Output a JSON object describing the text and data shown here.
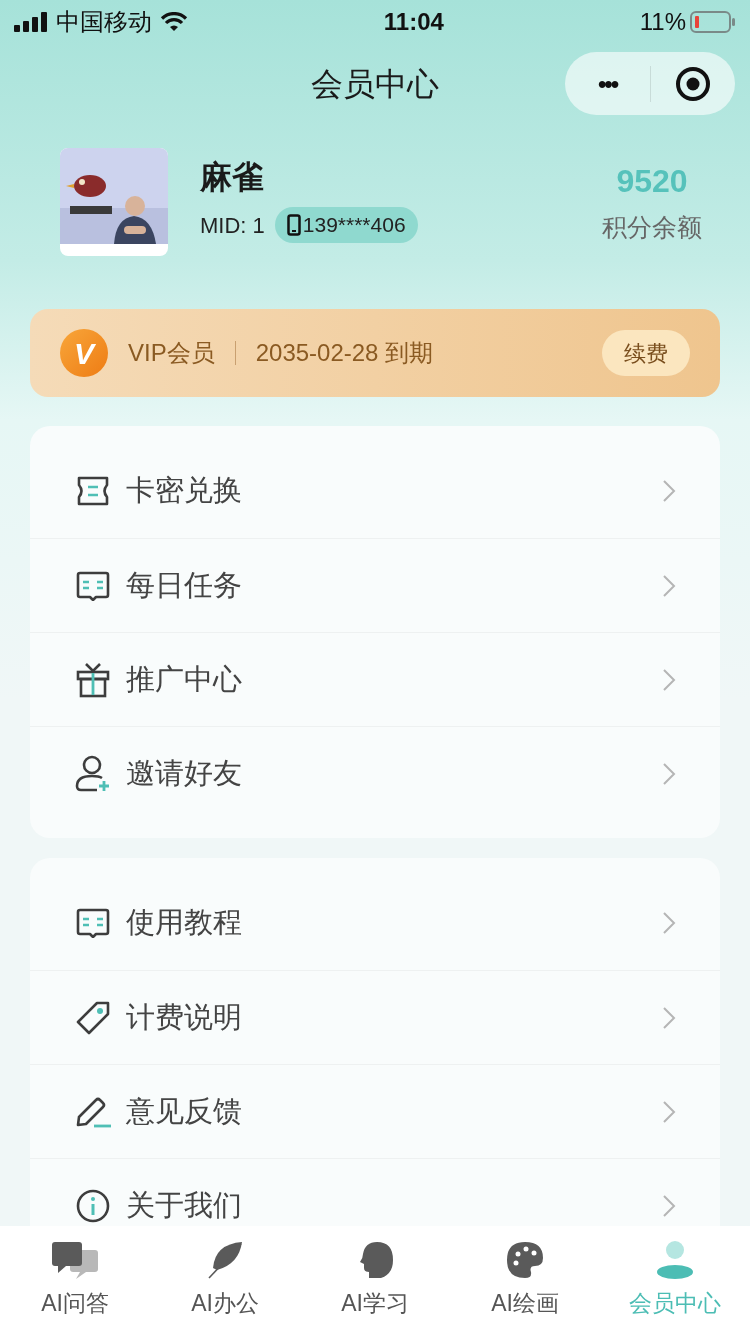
{
  "status_bar": {
    "carrier": "中国移动",
    "time": "11:04",
    "battery": "11%"
  },
  "nav": {
    "title": "会员中心",
    "more_icon": "•••"
  },
  "profile": {
    "name": "麻雀",
    "mid": "MID: 1",
    "phone": "139****406",
    "points": "9520",
    "points_label": "积分余额"
  },
  "vip": {
    "badge": "V",
    "label": "VIP会员",
    "expiry": "2035-02-28 到期",
    "button": "续费"
  },
  "menu_groups": [
    {
      "items": [
        {
          "label": "卡密兑换",
          "kind": "ticket"
        },
        {
          "label": "每日任务",
          "kind": "book"
        },
        {
          "label": "推广中心",
          "kind": "gift"
        },
        {
          "label": "邀请好友",
          "kind": "invite"
        }
      ]
    },
    {
      "items": [
        {
          "label": "使用教程",
          "kind": "book"
        },
        {
          "label": "计费说明",
          "kind": "tag"
        },
        {
          "label": "意见反馈",
          "kind": "pen"
        },
        {
          "label": "关于我们",
          "kind": "info"
        }
      ]
    }
  ],
  "tab_bar": [
    {
      "label": "AI问答",
      "kind": "chat",
      "selected": false
    },
    {
      "label": "AI办公",
      "kind": "feather",
      "selected": false
    },
    {
      "label": "AI学习",
      "kind": "head",
      "selected": false
    },
    {
      "label": "AI绘画",
      "kind": "palette",
      "selected": false
    },
    {
      "label": "会员中心",
      "kind": "person",
      "selected": true
    }
  ]
}
